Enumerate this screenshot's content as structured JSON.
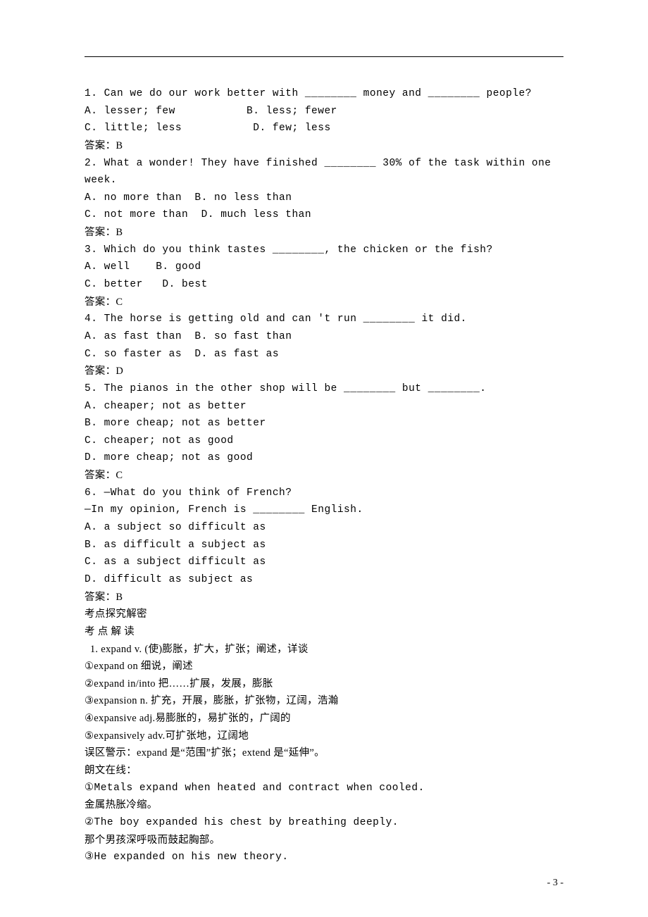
{
  "questions": [
    {
      "stem": "1. Can we do our work better with ________ money and ________ people?",
      "opts": [
        "A. lesser; few           B. less; fewer",
        "C. little; less           D. few; less"
      ],
      "ans": "答案：B"
    },
    {
      "stem": "2. What a wonder! They have finished ________ 30% of the task within one week.",
      "opts": [
        "A. no more than  B. no less than",
        "C. not more than  D. much less than"
      ],
      "ans": "答案：B"
    },
    {
      "stem": "3. Which do you think tastes ________, the chicken or the fish?",
      "opts": [
        "A. well    B. good",
        "C. better   D. best"
      ],
      "ans": "答案：C"
    },
    {
      "stem": "4. The horse is getting old and can 't run ________ it did.",
      "opts": [
        "A. as fast than  B. so fast than",
        "C. so faster as  D. as fast as"
      ],
      "ans": "答案：D"
    },
    {
      "stem": "5. The pianos in the other shop will be ________ but ________.",
      "opts": [
        "A. cheaper; not as better",
        "B. more cheap; not as better",
        "C. cheaper; not as good",
        "D. more cheap; not as good"
      ],
      "ans": "答案：C"
    },
    {
      "stem": "6. —What do you think of French?",
      "stem2": "—In my opinion, French is ________ English.",
      "opts": [
        "A. a subject so difficult as",
        "B. as difficult a subject as",
        "C. as a subject difficult as",
        "D. difficult as subject as"
      ],
      "ans": "答案：B"
    }
  ],
  "section_title": "考点探究解密",
  "section_sub": "考 点 解 读",
  "expand": {
    "head": "  1. expand v. (使)膨胀，扩大，扩张；阐述，详谈",
    "p1": "①expand on 细说，阐述",
    "p2": "②expand in/into 把……扩展，发展，膨胀",
    "p3": "③expansion n. 扩充，开展，膨胀，扩张物，辽阔，浩瀚",
    "p4": "④expansive adj.易膨胀的，易扩张的，广阔的",
    "p5": "⑤expansively adv.可扩张地，辽阔地",
    "warn": "误区警示：expand 是“范围”扩张；extend 是“延伸”。",
    "lw": "朗文在线：",
    "ex1a": "①Metals expand when heated and contract when cooled.",
    "ex1b": "金属热胀冷缩。",
    "ex2a": "②The boy expanded his chest by breathing deeply.",
    "ex2b": "那个男孩深呼吸而鼓起胸部。",
    "ex3a": "③He expanded on his new theory."
  },
  "page_number": "- 3 -"
}
